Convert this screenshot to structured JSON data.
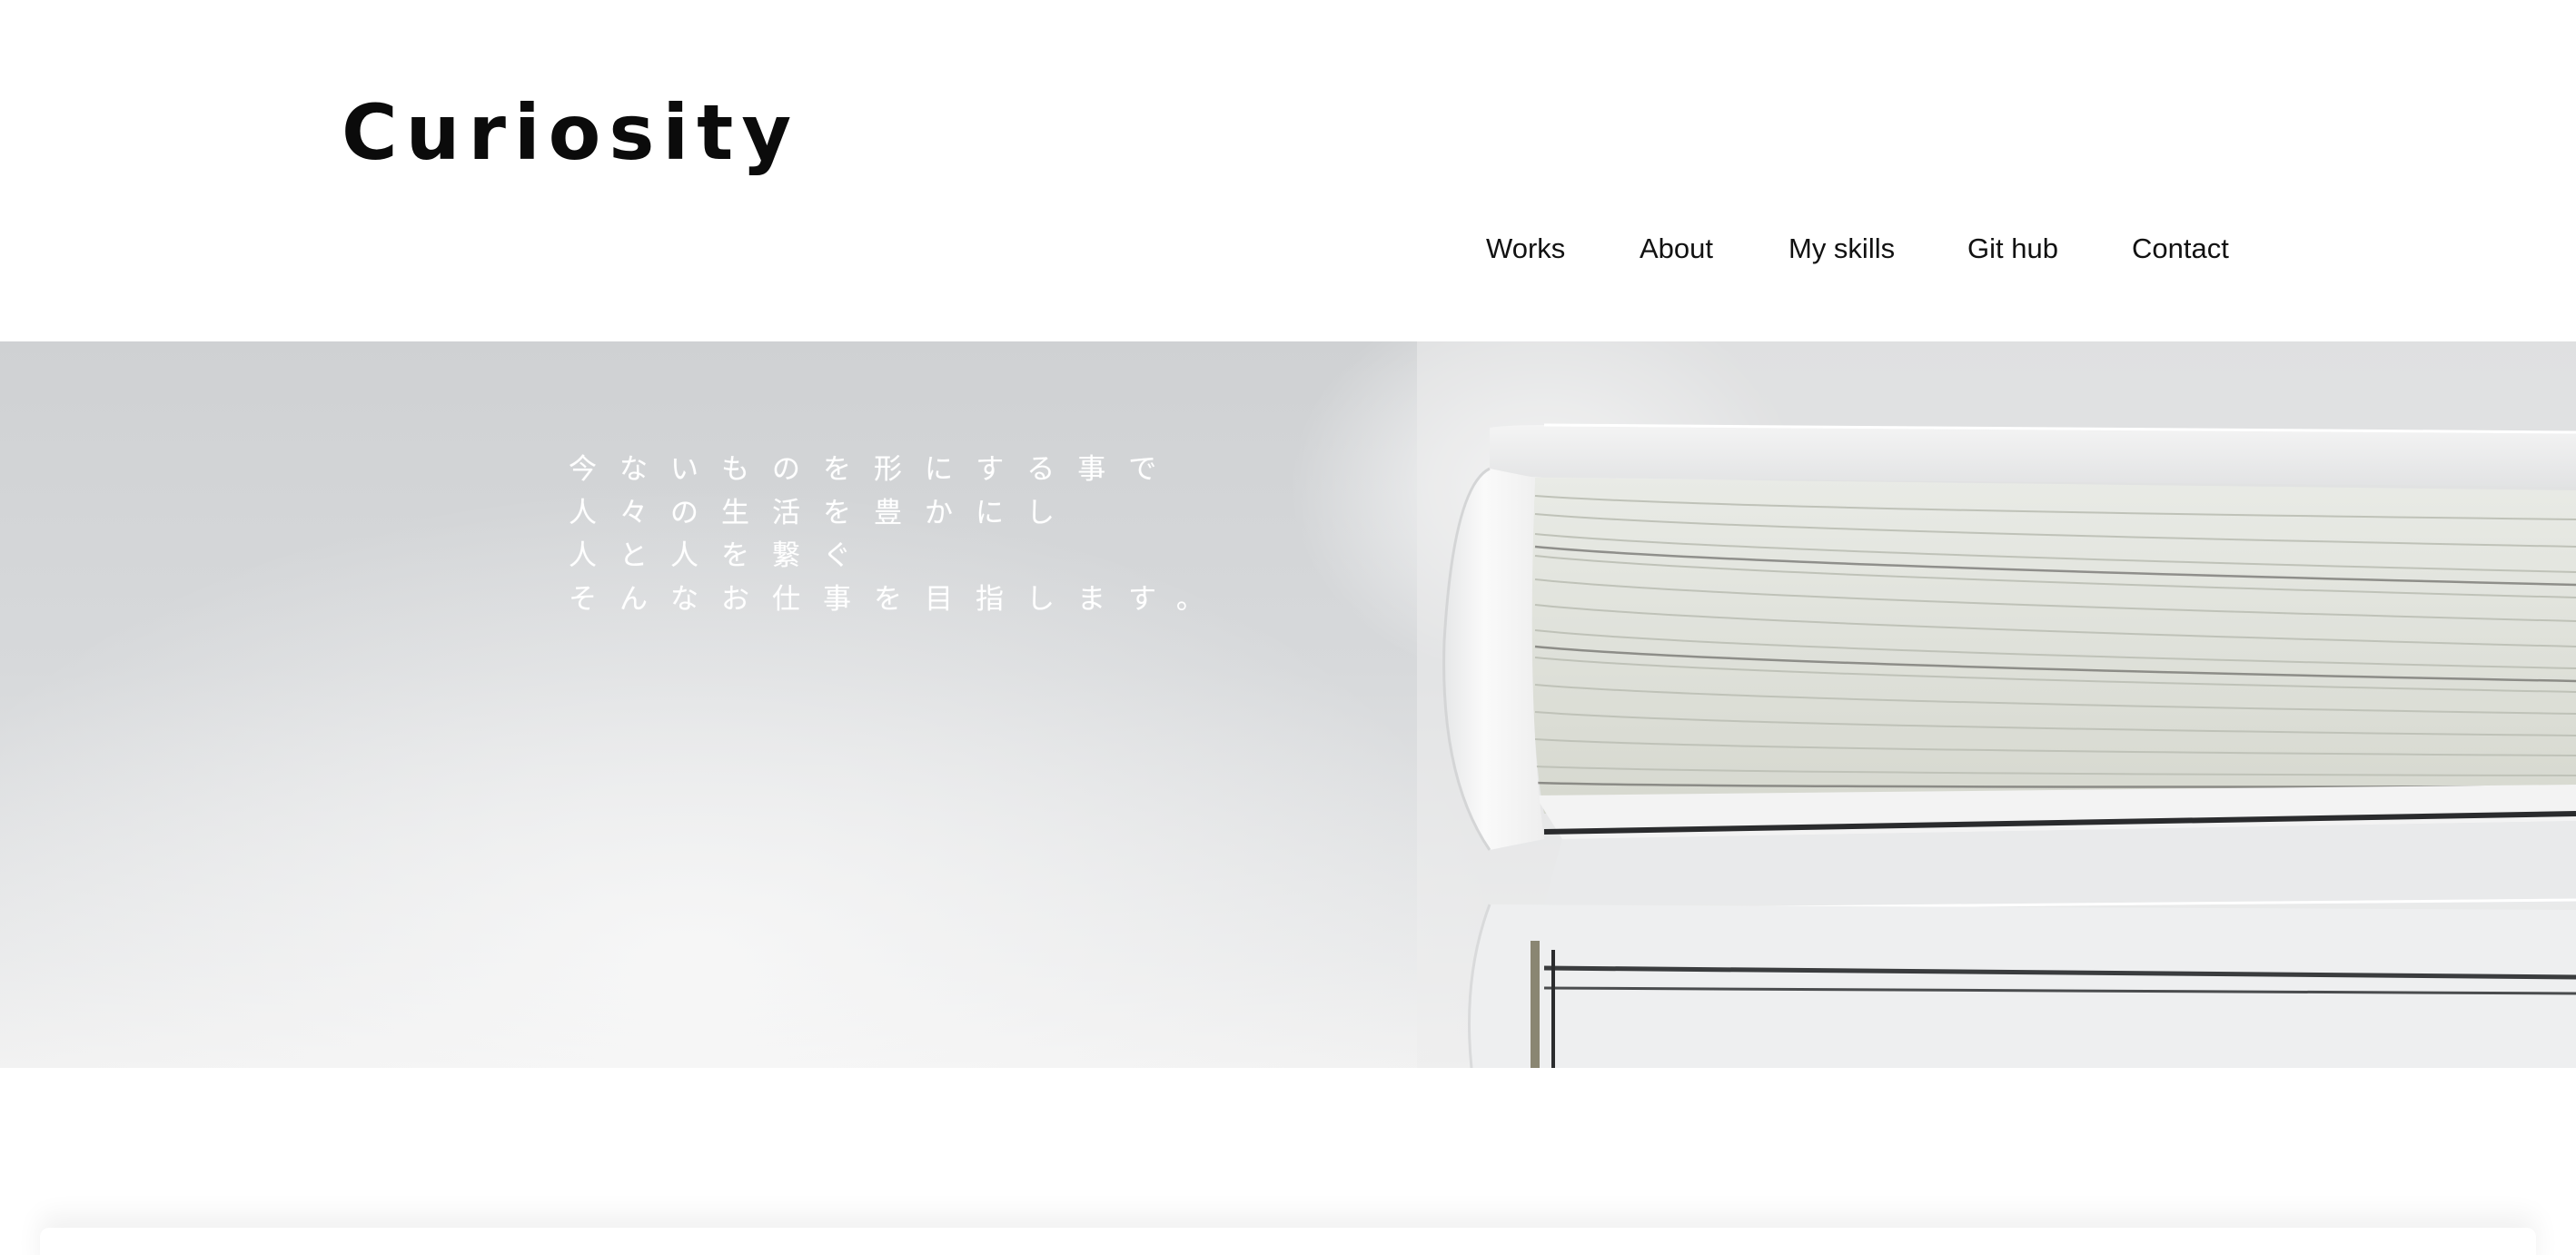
{
  "header": {
    "logo_text": "Curiosity",
    "nav": [
      {
        "label": "Works"
      },
      {
        "label": "About"
      },
      {
        "label": "My skills"
      },
      {
        "label": "Git hub"
      },
      {
        "label": "Contact"
      }
    ]
  },
  "hero": {
    "lines": [
      "今ないものを形にする事で",
      "人々の生活を豊かにし",
      "人と人を繋ぐ",
      "そんなお仕事を目指します。"
    ],
    "image_subject": "stacked white books"
  },
  "colors": {
    "text": "#111111",
    "hero_text": "#ffffff",
    "hero_background": "#d7d9db",
    "page_background": "#ffffff"
  }
}
